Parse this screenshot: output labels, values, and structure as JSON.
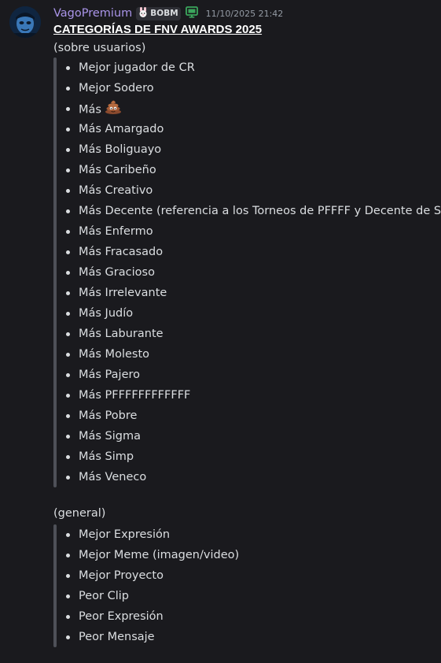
{
  "message": {
    "username": "VagoPremium",
    "clan_tag": "BOBM",
    "timestamp": "11/10/2025 21:42",
    "colors": {
      "username": "#a994e8",
      "background": "#1a1a1e",
      "text": "#dbdee1",
      "quote_bar": "#4e5058"
    },
    "title": "CATEGORÍAS DE FNV AWARDS 2025",
    "sections": [
      {
        "heading": "(sobre usuarios)",
        "items": [
          "Mejor jugador de CR",
          "Mejor Sodero",
          "Más",
          "Más Amargado",
          "Más Boliguayo",
          "Más Caribeño",
          "Más Creativo",
          "Más Decente (referencia a los Torneos de PFFFF y Decente de Sur)",
          "Más Enfermo",
          "Más Fracasado",
          "Más Gracioso",
          "Más Irrelevante",
          "Más Judío",
          "Más Laburante",
          "Más Molesto",
          "Más Pajero",
          "Más PFFFFFFFFFFFF",
          "Más Pobre",
          "Más Sigma",
          "Más Simp",
          "Más Veneco"
        ]
      },
      {
        "heading": "(general)",
        "items": [
          "Mejor Expresión",
          "Mejor Meme (imagen/video)",
          "Mejor Proyecto",
          "Peor Clip",
          "Peor Expresión",
          "Peor Mensaje"
        ]
      }
    ],
    "icons": {
      "avatar": "avatar-image",
      "clan_badge": "bunny-badge-icon",
      "monitor": "monitor-icon",
      "emoji": "poop-emoji-icon"
    }
  }
}
